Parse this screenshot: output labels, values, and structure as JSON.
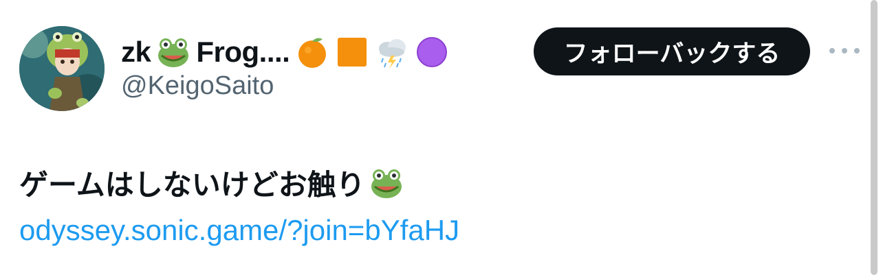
{
  "profile": {
    "display_name": "zk🐸Frog....🍊🟧⛈️🟣",
    "display_name_text_1": "zk",
    "display_name_text_2": "Frog....",
    "handle": "@KeigoSaito",
    "name_emojis": [
      "frog-emoji",
      "tangerine-emoji",
      "orange-square-emoji",
      "thunder-rain-cloud-emoji",
      "purple-circle-emoji"
    ]
  },
  "actions": {
    "follow_back_label": "フォローバックする",
    "more_icon": "more-dots-icon"
  },
  "tweet": {
    "text": "ゲームはしないけどお触り",
    "text_emoji": "frog-emoji",
    "link": "odyssey.sonic.game/?join=bYfaHJ"
  },
  "colors": {
    "text_primary": "#0f1419",
    "text_secondary": "#536471",
    "link": "#1d9bf0",
    "button_bg": "#0f1419",
    "button_text": "#ffffff"
  }
}
